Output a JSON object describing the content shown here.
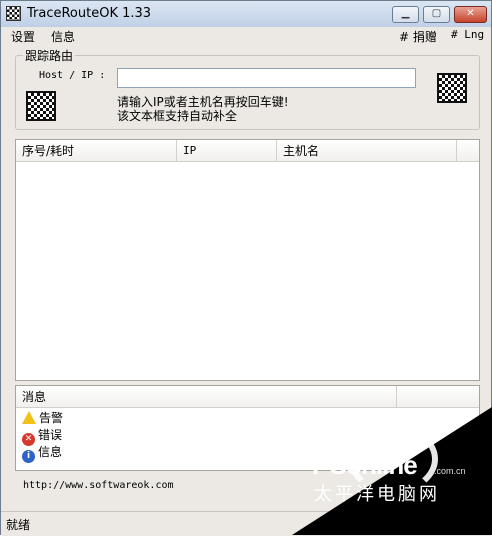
{
  "window": {
    "title": "TraceRouteOK 1.33"
  },
  "menu": {
    "left": [
      "设置",
      "信息"
    ],
    "right": [
      "# 捐赠",
      "# Lng"
    ]
  },
  "route": {
    "group_title": "跟踪路由",
    "host_label": "Host / IP :",
    "host_value": "",
    "hint_line1": "请输入IP或者主机名再按回车键!",
    "hint_line2": "该文本框支持自动补全"
  },
  "results": {
    "columns": [
      "序号/耗时",
      "IP",
      "主机名"
    ]
  },
  "messages": {
    "header": "消息",
    "items": [
      {
        "label": "告警",
        "icon": "warning-icon"
      },
      {
        "label": "错误",
        "icon": "error-icon"
      },
      {
        "label": "信息",
        "icon": "info-icon"
      }
    ]
  },
  "footer": {
    "url": "http://www.softwareok.com"
  },
  "status": {
    "text": "就绪"
  },
  "watermark": {
    "logo": "PConline",
    "domain": ".com.cn",
    "subtitle": "太平洋电脑网"
  }
}
